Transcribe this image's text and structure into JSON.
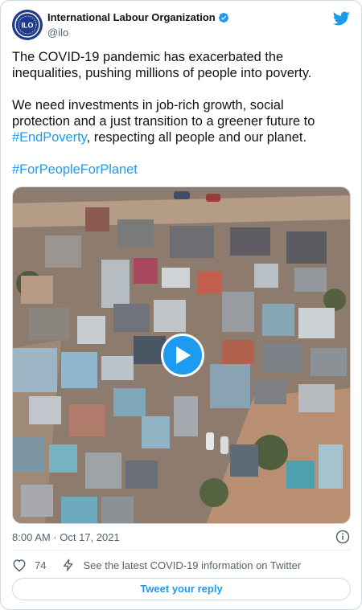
{
  "author": {
    "display_name": "International Labour Organization",
    "handle": "@ilo",
    "avatar_text": "ILO"
  },
  "tweet": {
    "line1": "The COVID-19 pandemic has exacerbated the",
    "line2": "inequalities, pushing millions of people into poverty.",
    "line3": "We need investments in job-rich growth, social",
    "line4": "protection and a just transition to a greener future to",
    "hashtag1": "#EndPoverty",
    "line5_rest": ", respecting all people and our planet.",
    "hashtag2": "#ForPeopleForPlanet"
  },
  "meta": {
    "timestamp": "8:00 AM · Oct 17, 2021"
  },
  "actions": {
    "like_count": "74",
    "covid_link": "See the latest COVID-19 information on Twitter",
    "reply_button": "Tweet your reply"
  },
  "colors": {
    "accent": "#1d9bf0",
    "like": "#536471",
    "avatar_bg": "#1e3a8a"
  },
  "icons": {
    "verified": "verified-badge-icon",
    "brand": "twitter-bird-icon",
    "play": "play-icon",
    "info": "info-icon",
    "like": "heart-icon",
    "covid": "lightning-icon"
  }
}
